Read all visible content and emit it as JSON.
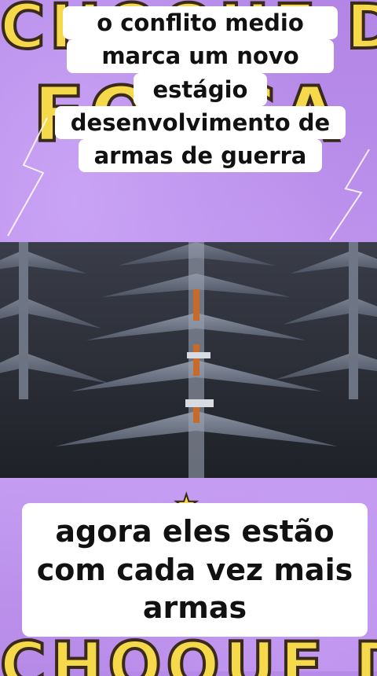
{
  "background": {
    "top_letters_1": "CHOQUE DE",
    "top_letters_2": "FORÇA",
    "bottom_letters": "CHOQUE DE"
  },
  "caption_top": {
    "line1": "o conflito medio",
    "line2": "marca um novo",
    "line3": "estágio",
    "line4": "desenvolvimento de",
    "line5": "armas de guerra"
  },
  "caption_bottom": {
    "line1": "agora eles estão",
    "line2": "com cada vez mais",
    "line3": "armas"
  },
  "video": {
    "subject": "rows of military drones"
  },
  "colors": {
    "background": "#b58ae8",
    "letters": "#f5d94a",
    "caption_bg": "#ffffff",
    "caption_text": "#111111"
  }
}
